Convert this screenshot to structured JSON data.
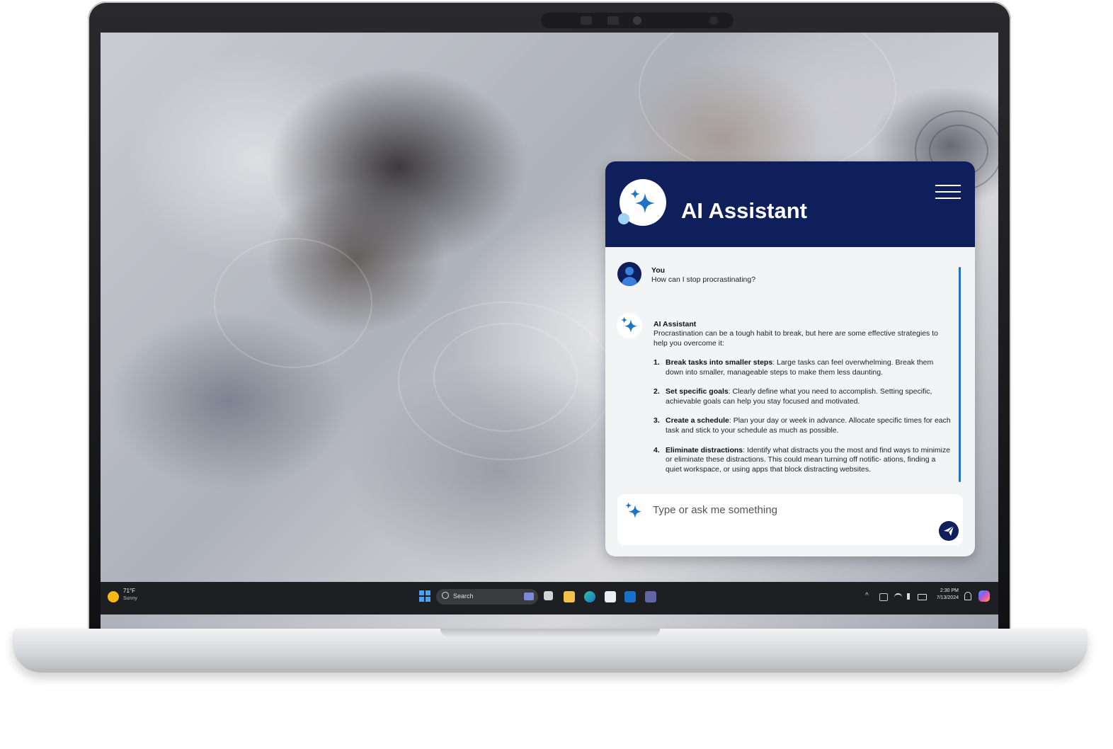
{
  "assistant": {
    "title": "AI Assistant",
    "menu_icon": "hamburger-menu-icon",
    "messages": [
      {
        "sender": "You",
        "text": "How can I stop procrastinating?"
      },
      {
        "sender": "AI Assistant",
        "intro": "Procrastination can be a tough habit to break, but here are some effective strategies to help you overcome it:",
        "steps": [
          {
            "number": "1.",
            "term": "Break tasks into smaller steps",
            "text": ": Large tasks can feel overwhelming. Break them down into smaller, manageable steps to make them less daunting."
          },
          {
            "number": "2.",
            "term": "Set specific goals",
            "text": ": Clearly define what you need to accomplish. Setting specific, achievable goals can help you stay focused and motivated."
          },
          {
            "number": "3.",
            "term": "Create a schedule",
            "text": ": Plan your day or week in advance. Allocate specific times for each task and stick to your schedule as much as possible."
          },
          {
            "number": "4.",
            "term": "Eliminate distractions",
            "text": ": Identify what distracts you the most and find ways to minimize or eliminate these distractions. This could mean turning off notific- ations, finding a quiet workspace, or using apps that block distracting websites."
          }
        ]
      }
    ],
    "input": {
      "placeholder": "Type or ask me something",
      "value": ""
    },
    "colors": {
      "header": "#0e1f5c",
      "accent": "#1f73c9",
      "panel_bg": "#f3f4f6"
    }
  },
  "taskbar": {
    "weather": {
      "temp": "71°F",
      "condition": "Sunny"
    },
    "search": {
      "label": "Search"
    },
    "apps": [
      "start-icon",
      "task-view-icon",
      "file-explorer-icon",
      "edge-icon",
      "store-icon",
      "outlook-icon",
      "teams-icon"
    ],
    "tray": {
      "time": "2:30 PM",
      "date": "7/13/2024"
    }
  }
}
